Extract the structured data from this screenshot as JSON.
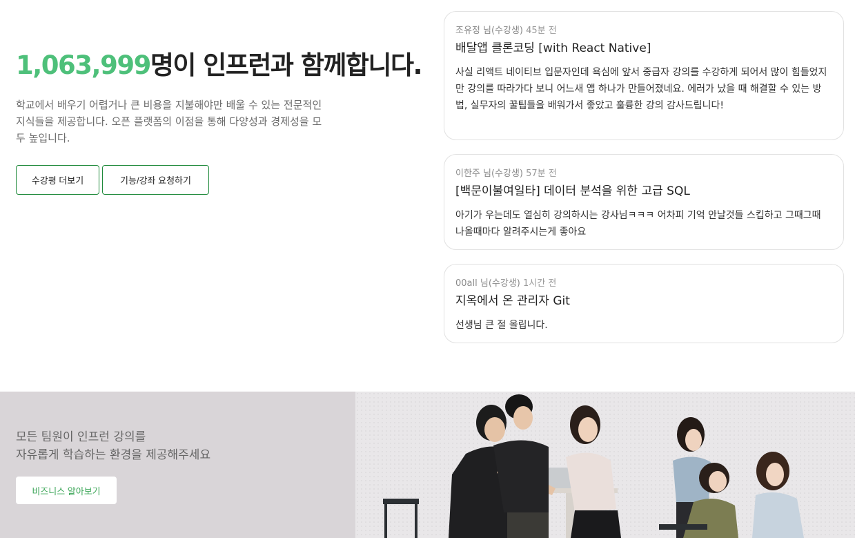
{
  "hero": {
    "count": "1,063,999",
    "headline_rest": "명이 인프런과 함께합니다.",
    "description": "학교에서 배우기 어렵거나 큰 비용을 지불해야만 배울 수 있는 전문적인 지식들을 제공합니다. 오픈 플랫폼의 이점을 통해 다양성과 경제성을 모두 높입니다.",
    "buttons": {
      "reviews": "수강평 더보기",
      "request": "기능/강좌 요청하기"
    },
    "accent_color": "#4ec07a"
  },
  "reviews": [
    {
      "author": "조유정 님(수강생)",
      "time": "45분 전",
      "course": "배달앱 클론코딩 [with React Native]",
      "text": "사실 리액트 네이티브 입문자인데 욕심에 앞서 중급자 강의를 수강하게 되어서 많이 힘들었지만 강의를 따라가다 보니 어느새 앱 하나가 만들어졌네요. 에러가 났을 때 해결할 수 있는 방법, 실무자의 꿀팁들을 배워가서 좋았고 훌륭한 강의 감사드립니다!"
    },
    {
      "author": "이한주 님(수강생)",
      "time": "57분 전",
      "course": "[백문이불여일타] 데이터 분석을 위한 고급 SQL",
      "text": "아기가 우는데도 열심히 강의하시는 강사님ㅋㅋㅋ 어차피 기억 안날것들 스킵하고 그때그때 나올때마다 알려주시는게 좋아요"
    },
    {
      "author": "00all 님(수강생)",
      "time": "1시간 전",
      "course": "지옥에서 온 관리자 Git",
      "text": "선생님 큰 절 올립니다."
    }
  ],
  "banner": {
    "line1": "모든 팀원이 인프런 강의를",
    "line2": "자유롭게 학습하는 환경을 제공해주세요",
    "button": "비즈니스 알아보기",
    "background": "#d9d5d8"
  }
}
